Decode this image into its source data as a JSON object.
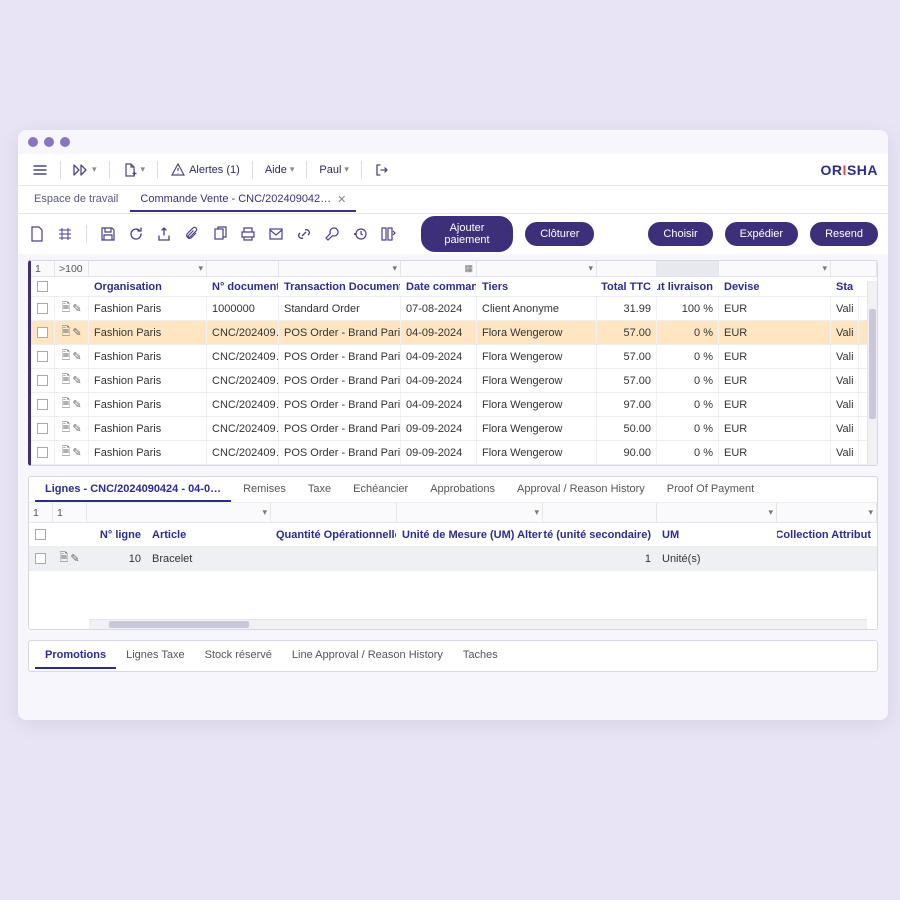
{
  "topbar": {
    "alerts_label": "Alertes (1)",
    "help_label": "Aide",
    "user_label": "Paul"
  },
  "logo": {
    "pre": "OR",
    "mid": "I",
    "post": "SHA"
  },
  "tabs": {
    "workspace": "Espace de travail",
    "current": "Commande Vente - CNC/202409042…"
  },
  "actions": {
    "add_payment": "Ajouter paiement",
    "close": "Clôturer",
    "choose": "Choisir",
    "ship": "Expédier",
    "resend": "Resend"
  },
  "grid": {
    "pager_page": "1",
    "pager_range": ">100",
    "headers": {
      "org": "Organisation",
      "doc": "N° document",
      "tdoc": "Transaction Document",
      "date": "Date commande",
      "tier": "Tiers",
      "ttc": "Total TTC",
      "stat": "Statut livraison",
      "dev": "Devise",
      "sta": "Sta"
    },
    "rows": [
      {
        "org": "Fashion Paris",
        "doc": "1000000",
        "tdoc": "Standard Order",
        "date": "07-08-2024",
        "tier": "Client Anonyme",
        "ttc": "31.99",
        "stat": "100 %",
        "dev": "EUR",
        "sta": "Vali",
        "sel": false
      },
      {
        "org": "Fashion Paris",
        "doc": "CNC/202409…",
        "tdoc": "POS Order - Brand Paris",
        "date": "04-09-2024",
        "tier": "Flora Wengerow",
        "ttc": "57.00",
        "stat": "0 %",
        "dev": "EUR",
        "sta": "Vali",
        "sel": true
      },
      {
        "org": "Fashion Paris",
        "doc": "CNC/202409…",
        "tdoc": "POS Order - Brand Paris",
        "date": "04-09-2024",
        "tier": "Flora Wengerow",
        "ttc": "57.00",
        "stat": "0 %",
        "dev": "EUR",
        "sta": "Vali",
        "sel": false
      },
      {
        "org": "Fashion Paris",
        "doc": "CNC/202409…",
        "tdoc": "POS Order - Brand Paris",
        "date": "04-09-2024",
        "tier": "Flora Wengerow",
        "ttc": "57.00",
        "stat": "0 %",
        "dev": "EUR",
        "sta": "Vali",
        "sel": false
      },
      {
        "org": "Fashion Paris",
        "doc": "CNC/202409…",
        "tdoc": "POS Order - Brand Paris",
        "date": "04-09-2024",
        "tier": "Flora Wengerow",
        "ttc": "97.00",
        "stat": "0 %",
        "dev": "EUR",
        "sta": "Vali",
        "sel": false
      },
      {
        "org": "Fashion Paris",
        "doc": "CNC/202409…",
        "tdoc": "POS Order - Brand Paris",
        "date": "09-09-2024",
        "tier": "Flora Wengerow",
        "ttc": "50.00",
        "stat": "0 %",
        "dev": "EUR",
        "sta": "Vali",
        "sel": false
      },
      {
        "org": "Fashion Paris",
        "doc": "CNC/202409…",
        "tdoc": "POS Order - Brand Paris",
        "date": "09-09-2024",
        "tier": "Flora Wengerow",
        "ttc": "90.00",
        "stat": "0 %",
        "dev": "EUR",
        "sta": "Vali",
        "sel": false
      }
    ]
  },
  "detail": {
    "tab_title": "Lignes - CNC/2024090424 - 04-0…",
    "tabs": [
      "Remises",
      "Taxe",
      "Echéancier",
      "Approbations",
      "Approval / Reason History",
      "Proof Of Payment"
    ],
    "pager_a": "1",
    "pager_b": "1",
    "headers": {
      "num": "N° ligne",
      "art": "Article",
      "qop": "Quantité Opérationnelle",
      "um": "Unité de Mesure (UM) Alternative",
      "qs": "Quantité (unité secondaire)",
      "um2": "UM",
      "val": "Valeur Collection Attribut"
    },
    "row": {
      "num": "10",
      "art": "Bracelet",
      "qop": "",
      "um": "",
      "qs": "1",
      "um2": "Unité(s)",
      "val": ""
    }
  },
  "bottom_tabs": [
    "Promotions",
    "Lignes Taxe",
    "Stock réservé",
    "Line Approval / Reason History",
    "Taches"
  ]
}
